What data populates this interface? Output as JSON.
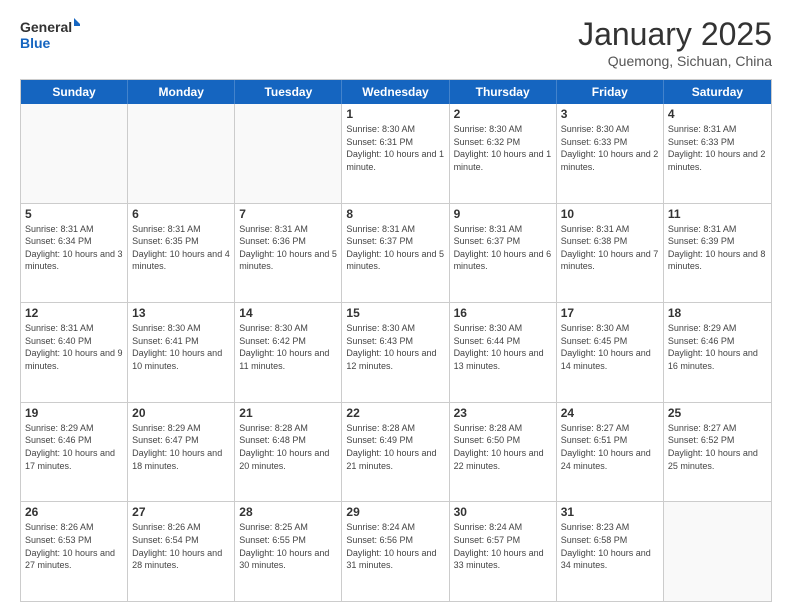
{
  "header": {
    "logo_general": "General",
    "logo_blue": "Blue",
    "month_title": "January 2025",
    "location": "Quemong, Sichuan, China"
  },
  "weekdays": [
    "Sunday",
    "Monday",
    "Tuesday",
    "Wednesday",
    "Thursday",
    "Friday",
    "Saturday"
  ],
  "weeks": [
    [
      {
        "day": "",
        "sunrise": "",
        "sunset": "",
        "daylight": ""
      },
      {
        "day": "",
        "sunrise": "",
        "sunset": "",
        "daylight": ""
      },
      {
        "day": "",
        "sunrise": "",
        "sunset": "",
        "daylight": ""
      },
      {
        "day": "1",
        "sunrise": "Sunrise: 8:30 AM",
        "sunset": "Sunset: 6:31 PM",
        "daylight": "Daylight: 10 hours and 1 minute."
      },
      {
        "day": "2",
        "sunrise": "Sunrise: 8:30 AM",
        "sunset": "Sunset: 6:32 PM",
        "daylight": "Daylight: 10 hours and 1 minute."
      },
      {
        "day": "3",
        "sunrise": "Sunrise: 8:30 AM",
        "sunset": "Sunset: 6:33 PM",
        "daylight": "Daylight: 10 hours and 2 minutes."
      },
      {
        "day": "4",
        "sunrise": "Sunrise: 8:31 AM",
        "sunset": "Sunset: 6:33 PM",
        "daylight": "Daylight: 10 hours and 2 minutes."
      }
    ],
    [
      {
        "day": "5",
        "sunrise": "Sunrise: 8:31 AM",
        "sunset": "Sunset: 6:34 PM",
        "daylight": "Daylight: 10 hours and 3 minutes."
      },
      {
        "day": "6",
        "sunrise": "Sunrise: 8:31 AM",
        "sunset": "Sunset: 6:35 PM",
        "daylight": "Daylight: 10 hours and 4 minutes."
      },
      {
        "day": "7",
        "sunrise": "Sunrise: 8:31 AM",
        "sunset": "Sunset: 6:36 PM",
        "daylight": "Daylight: 10 hours and 5 minutes."
      },
      {
        "day": "8",
        "sunrise": "Sunrise: 8:31 AM",
        "sunset": "Sunset: 6:37 PM",
        "daylight": "Daylight: 10 hours and 5 minutes."
      },
      {
        "day": "9",
        "sunrise": "Sunrise: 8:31 AM",
        "sunset": "Sunset: 6:37 PM",
        "daylight": "Daylight: 10 hours and 6 minutes."
      },
      {
        "day": "10",
        "sunrise": "Sunrise: 8:31 AM",
        "sunset": "Sunset: 6:38 PM",
        "daylight": "Daylight: 10 hours and 7 minutes."
      },
      {
        "day": "11",
        "sunrise": "Sunrise: 8:31 AM",
        "sunset": "Sunset: 6:39 PM",
        "daylight": "Daylight: 10 hours and 8 minutes."
      }
    ],
    [
      {
        "day": "12",
        "sunrise": "Sunrise: 8:31 AM",
        "sunset": "Sunset: 6:40 PM",
        "daylight": "Daylight: 10 hours and 9 minutes."
      },
      {
        "day": "13",
        "sunrise": "Sunrise: 8:30 AM",
        "sunset": "Sunset: 6:41 PM",
        "daylight": "Daylight: 10 hours and 10 minutes."
      },
      {
        "day": "14",
        "sunrise": "Sunrise: 8:30 AM",
        "sunset": "Sunset: 6:42 PM",
        "daylight": "Daylight: 10 hours and 11 minutes."
      },
      {
        "day": "15",
        "sunrise": "Sunrise: 8:30 AM",
        "sunset": "Sunset: 6:43 PM",
        "daylight": "Daylight: 10 hours and 12 minutes."
      },
      {
        "day": "16",
        "sunrise": "Sunrise: 8:30 AM",
        "sunset": "Sunset: 6:44 PM",
        "daylight": "Daylight: 10 hours and 13 minutes."
      },
      {
        "day": "17",
        "sunrise": "Sunrise: 8:30 AM",
        "sunset": "Sunset: 6:45 PM",
        "daylight": "Daylight: 10 hours and 14 minutes."
      },
      {
        "day": "18",
        "sunrise": "Sunrise: 8:29 AM",
        "sunset": "Sunset: 6:46 PM",
        "daylight": "Daylight: 10 hours and 16 minutes."
      }
    ],
    [
      {
        "day": "19",
        "sunrise": "Sunrise: 8:29 AM",
        "sunset": "Sunset: 6:46 PM",
        "daylight": "Daylight: 10 hours and 17 minutes."
      },
      {
        "day": "20",
        "sunrise": "Sunrise: 8:29 AM",
        "sunset": "Sunset: 6:47 PM",
        "daylight": "Daylight: 10 hours and 18 minutes."
      },
      {
        "day": "21",
        "sunrise": "Sunrise: 8:28 AM",
        "sunset": "Sunset: 6:48 PM",
        "daylight": "Daylight: 10 hours and 20 minutes."
      },
      {
        "day": "22",
        "sunrise": "Sunrise: 8:28 AM",
        "sunset": "Sunset: 6:49 PM",
        "daylight": "Daylight: 10 hours and 21 minutes."
      },
      {
        "day": "23",
        "sunrise": "Sunrise: 8:28 AM",
        "sunset": "Sunset: 6:50 PM",
        "daylight": "Daylight: 10 hours and 22 minutes."
      },
      {
        "day": "24",
        "sunrise": "Sunrise: 8:27 AM",
        "sunset": "Sunset: 6:51 PM",
        "daylight": "Daylight: 10 hours and 24 minutes."
      },
      {
        "day": "25",
        "sunrise": "Sunrise: 8:27 AM",
        "sunset": "Sunset: 6:52 PM",
        "daylight": "Daylight: 10 hours and 25 minutes."
      }
    ],
    [
      {
        "day": "26",
        "sunrise": "Sunrise: 8:26 AM",
        "sunset": "Sunset: 6:53 PM",
        "daylight": "Daylight: 10 hours and 27 minutes."
      },
      {
        "day": "27",
        "sunrise": "Sunrise: 8:26 AM",
        "sunset": "Sunset: 6:54 PM",
        "daylight": "Daylight: 10 hours and 28 minutes."
      },
      {
        "day": "28",
        "sunrise": "Sunrise: 8:25 AM",
        "sunset": "Sunset: 6:55 PM",
        "daylight": "Daylight: 10 hours and 30 minutes."
      },
      {
        "day": "29",
        "sunrise": "Sunrise: 8:24 AM",
        "sunset": "Sunset: 6:56 PM",
        "daylight": "Daylight: 10 hours and 31 minutes."
      },
      {
        "day": "30",
        "sunrise": "Sunrise: 8:24 AM",
        "sunset": "Sunset: 6:57 PM",
        "daylight": "Daylight: 10 hours and 33 minutes."
      },
      {
        "day": "31",
        "sunrise": "Sunrise: 8:23 AM",
        "sunset": "Sunset: 6:58 PM",
        "daylight": "Daylight: 10 hours and 34 minutes."
      },
      {
        "day": "",
        "sunrise": "",
        "sunset": "",
        "daylight": ""
      }
    ]
  ]
}
